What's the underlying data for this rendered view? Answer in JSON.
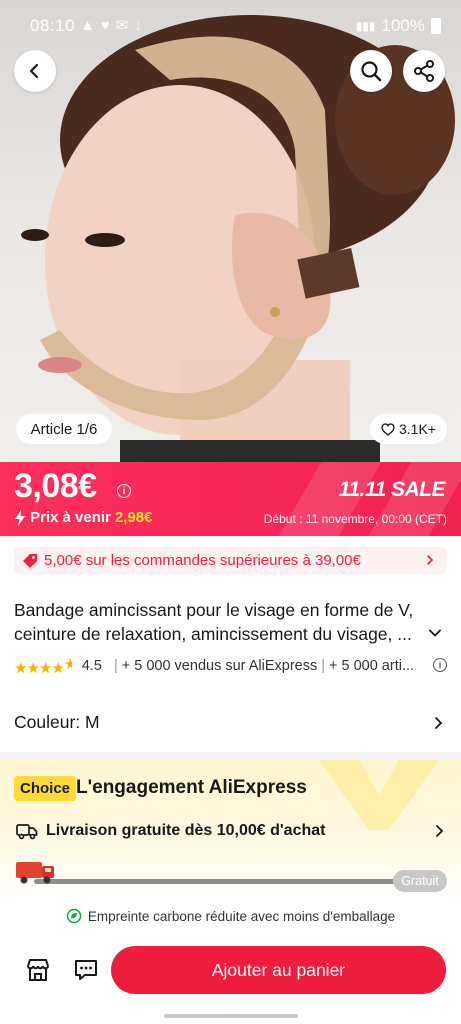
{
  "status_bar": {
    "time": "08:10",
    "battery": "100%"
  },
  "gallery": {
    "article_counter": "Article 1/6",
    "likes": "3.1K+"
  },
  "price": {
    "current": "3,08€",
    "future_label": "Prix à venir",
    "future_price": "2,98€",
    "sale_title": "11.11 SALE",
    "sale_start": "Début : 11 novembre, 00:00 (CET)"
  },
  "coupon": {
    "text": "5,00€ sur les commandes supérieures à 39,00€"
  },
  "product": {
    "title": "Bandage amincissant pour le visage en forme de V, ceinture de relaxation, amincissement du visage, ...",
    "rating_value": 4.5,
    "rating": "4.5",
    "sold_1": "+ 5 000 vendus sur AliExpress",
    "sold_2": "+ 5 000 arti..."
  },
  "variant": {
    "color_label": "Couleur: M"
  },
  "choice": {
    "badge": "Choice",
    "title": "L'engagement AliExpress",
    "delivery": "Livraison gratuite dès 10,00€ d'achat",
    "progress_badge": "Gratuit",
    "carbon": "Empreinte carbone réduite avec moins d'emballage"
  },
  "bottom_bar": {
    "add_to_cart": "Ajouter au panier"
  },
  "colors": {
    "brand_red": "#ef1d3d",
    "banner_pink": "#ff2e5b",
    "future_price_yellow": "#ffe61c",
    "choice_yellow": "#ffd93a",
    "star": "#f6b400"
  },
  "icons": [
    "back-icon",
    "search-icon",
    "share-icon",
    "heart-icon",
    "info-icon",
    "bolt-icon",
    "coupon-tag-icon",
    "chevron-right-icon",
    "chevron-down-icon",
    "truck-icon",
    "leaf-icon",
    "store-icon",
    "chat-icon"
  ]
}
